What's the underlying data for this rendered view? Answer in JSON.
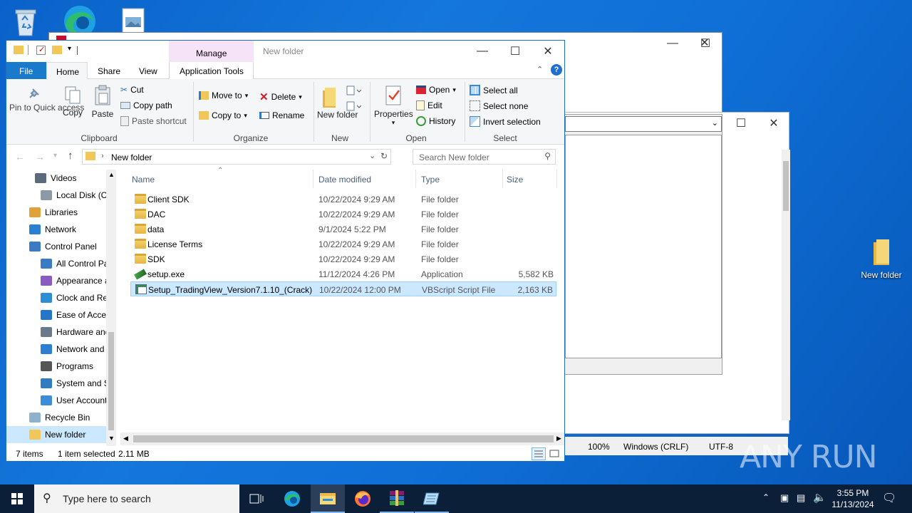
{
  "desktop": {
    "icons": [
      {
        "label": "New folder",
        "name": "desktop-new-folder"
      }
    ]
  },
  "notepad": {
    "status": {
      "zoom": "100%",
      "line_ending": "Windows (CRLF)",
      "encoding": "UTF-8"
    }
  },
  "watermark": "ANY RUN",
  "explorer": {
    "title": "New folder",
    "context_tab": "Manage",
    "tabs": [
      "File",
      "Home",
      "Share",
      "View",
      "Application Tools"
    ],
    "ribbon": {
      "clipboard": {
        "pin": "Pin to Quick access",
        "copy": "Copy",
        "paste": "Paste",
        "cut": "Cut",
        "copy_path": "Copy path",
        "paste_shortcut": "Paste shortcut",
        "label": "Clipboard"
      },
      "organize": {
        "move_to": "Move to",
        "copy_to": "Copy to",
        "delete": "Delete",
        "rename": "Rename",
        "label": "Organize"
      },
      "new": {
        "new_folder": "New folder",
        "label": "New"
      },
      "open": {
        "properties": "Properties",
        "open": "Open",
        "edit": "Edit",
        "history": "History",
        "label": "Open"
      },
      "select": {
        "select_all": "Select all",
        "select_none": "Select none",
        "invert": "Invert selection",
        "label": "Select"
      }
    },
    "address": {
      "path": "New folder",
      "search_placeholder": "Search New folder"
    },
    "nav": [
      {
        "label": "Videos",
        "icon": "videos-icon"
      },
      {
        "label": "Local Disk (C:)",
        "icon": "disk-icon"
      },
      {
        "label": "Libraries",
        "icon": "libraries-icon"
      },
      {
        "label": "Network",
        "icon": "network-icon"
      },
      {
        "label": "Control Panel",
        "icon": "control-panel-icon"
      },
      {
        "label": "All Control Par",
        "icon": "control-panel-icon"
      },
      {
        "label": "Appearance an",
        "icon": "appearance-icon"
      },
      {
        "label": "Clock and Regi",
        "icon": "clock-icon"
      },
      {
        "label": "Ease of Access",
        "icon": "ease-access-icon"
      },
      {
        "label": "Hardware and",
        "icon": "hardware-icon"
      },
      {
        "label": "Network and Ir",
        "icon": "network-internet-icon"
      },
      {
        "label": "Programs",
        "icon": "programs-icon"
      },
      {
        "label": "System and Sec",
        "icon": "system-security-icon"
      },
      {
        "label": "User Accounts",
        "icon": "user-accounts-icon"
      },
      {
        "label": "Recycle Bin",
        "icon": "recycle-bin-icon"
      },
      {
        "label": "New folder",
        "icon": "folder-icon"
      }
    ],
    "columns": {
      "name": "Name",
      "date": "Date modified",
      "type": "Type",
      "size": "Size"
    },
    "files": [
      {
        "name": "Client SDK",
        "date": "10/22/2024 9:29 AM",
        "type": "File folder",
        "size": "",
        "kind": "folder"
      },
      {
        "name": "DAC",
        "date": "10/22/2024 9:29 AM",
        "type": "File folder",
        "size": "",
        "kind": "folder"
      },
      {
        "name": "data",
        "date": "9/1/2024 5:22 PM",
        "type": "File folder",
        "size": "",
        "kind": "folder"
      },
      {
        "name": "License Terms",
        "date": "10/22/2024 9:29 AM",
        "type": "File folder",
        "size": "",
        "kind": "folder"
      },
      {
        "name": "SDK",
        "date": "10/22/2024 9:29 AM",
        "type": "File folder",
        "size": "",
        "kind": "folder"
      },
      {
        "name": "setup.exe",
        "date": "11/12/2024 4:26 PM",
        "type": "Application",
        "size": "5,582 KB",
        "kind": "exe"
      },
      {
        "name": "Setup_TradingView_Version7.1.10_(Crack)...",
        "date": "10/22/2024 12:00 PM",
        "type": "VBScript Script File",
        "size": "2,163 KB",
        "kind": "vbs",
        "selected": true
      }
    ],
    "status": {
      "count": "7 items",
      "selection": "1 item selected",
      "size": "2.11 MB"
    }
  },
  "taskbar": {
    "search_placeholder": "Type here to search",
    "time": "3:55 PM",
    "date": "11/13/2024"
  }
}
